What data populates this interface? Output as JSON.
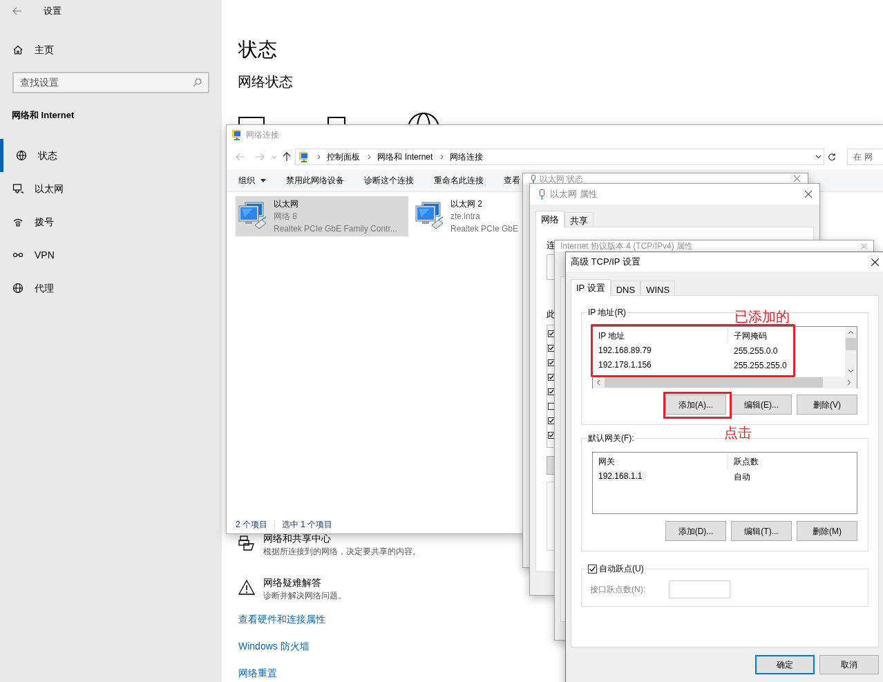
{
  "settings": {
    "title": "设置",
    "home": "主页",
    "search": {
      "placeholder": "查找设置"
    },
    "section": "网络和 Internet",
    "nav": [
      {
        "label": "状态",
        "kind": "status",
        "selected": true
      },
      {
        "label": "以太网",
        "kind": "ethernet",
        "selected": false
      },
      {
        "label": "拨号",
        "kind": "dialup",
        "selected": false
      },
      {
        "label": "VPN",
        "kind": "vpn",
        "selected": false
      },
      {
        "label": "代理",
        "kind": "proxy",
        "selected": false
      }
    ]
  },
  "status_page": {
    "title": "状态",
    "heading": "网络状态",
    "entries": [
      {
        "kind": "sharing",
        "title": "网络和共享中心",
        "description": "根据所连接到的网络，决定要共享的内容。"
      },
      {
        "kind": "troubleshoot",
        "title": "网络疑难解答",
        "description": "诊断并解决网络问题。"
      }
    ],
    "links": [
      "查看硬件和连接属性",
      "Windows 防火墙",
      "网络重置"
    ]
  },
  "connections_window": {
    "title": "网络连接",
    "breadcrumbs": [
      "控制面板",
      "网络和 Internet",
      "网络连接"
    ],
    "search": {
      "placeholder": "在 网"
    },
    "toolbar": [
      {
        "label": "组织",
        "kind": "menu"
      },
      {
        "label": "禁用此网络设备",
        "kind": "button"
      },
      {
        "label": "诊断这个连接",
        "kind": "button"
      },
      {
        "label": "重命名此连接",
        "kind": "button"
      },
      {
        "label": "查看",
        "kind": "button"
      }
    ],
    "items": [
      {
        "name": "以太网",
        "network": "网络 8",
        "adapter": "Realtek PCIe GbE Family Contr...",
        "selected": true
      },
      {
        "name": "以太网 2",
        "network": "zte.intra",
        "adapter": "Realtek PCIe GbE",
        "selected": false
      }
    ],
    "status_bar": [
      "2 个项目",
      "选中 1 个项目"
    ]
  },
  "status_dialog": {
    "title": "以太网 状态"
  },
  "properties_dialog": {
    "title": "以太网 属性",
    "tabs": [
      {
        "label": "网络",
        "selected": true
      },
      {
        "label": "共享",
        "selected": false
      }
    ],
    "labels": [
      "连",
      "此"
    ],
    "components": [
      {
        "checked": true
      },
      {
        "checked": true
      },
      {
        "checked": true
      },
      {
        "checked": true
      },
      {
        "checked": true
      },
      {
        "checked": false
      },
      {
        "checked": true
      },
      {
        "checked": true
      }
    ]
  },
  "ipv4_dialog": {
    "title": "Internet 协议版本 4 (TCP/IPv4) 属性"
  },
  "advanced_dialog": {
    "title": "高级 TCP/IP 设置",
    "tabs": [
      {
        "label": "IP 设置",
        "selected": true
      },
      {
        "label": "DNS",
        "selected": false
      },
      {
        "label": "WINS",
        "selected": false
      }
    ],
    "ip_group": {
      "label": "IP 地址(R)",
      "highlighted": true,
      "columns": [
        "IP 地址",
        "子网掩码"
      ],
      "rows": [
        {
          "cells": [
            "192.168.89.79",
            "255.255.0.0"
          ],
          "selected": false
        },
        {
          "cells": [
            "192.178.1.156",
            "255.255.255.0"
          ],
          "selected": false
        }
      ],
      "buttons": [
        {
          "label": "添加(A)...",
          "highlighted": true
        },
        {
          "label": "编辑(E)...",
          "highlighted": false
        },
        {
          "label": "删除(V)",
          "highlighted": false
        }
      ]
    },
    "gateway_group": {
      "label": "默认网关(F):",
      "columns": [
        "网关",
        "跃点数"
      ],
      "rows": [
        {
          "cells": [
            "192.168.1.1",
            "自动"
          ],
          "selected": true
        }
      ],
      "buttons": [
        {
          "label": "添加(D)..."
        },
        {
          "label": "编辑(T)..."
        },
        {
          "label": "删除(M)"
        }
      ]
    },
    "auto_metric": {
      "label": "自动跃点(U)",
      "checked": true
    },
    "interface_metric": {
      "label": "接口跃点数(N):",
      "disabled": true
    },
    "buttons": [
      {
        "label": "确定",
        "default": true
      },
      {
        "label": "取消",
        "default": false
      }
    ]
  },
  "annotations": [
    {
      "text": "已添加的"
    },
    {
      "text": "点击"
    }
  ]
}
